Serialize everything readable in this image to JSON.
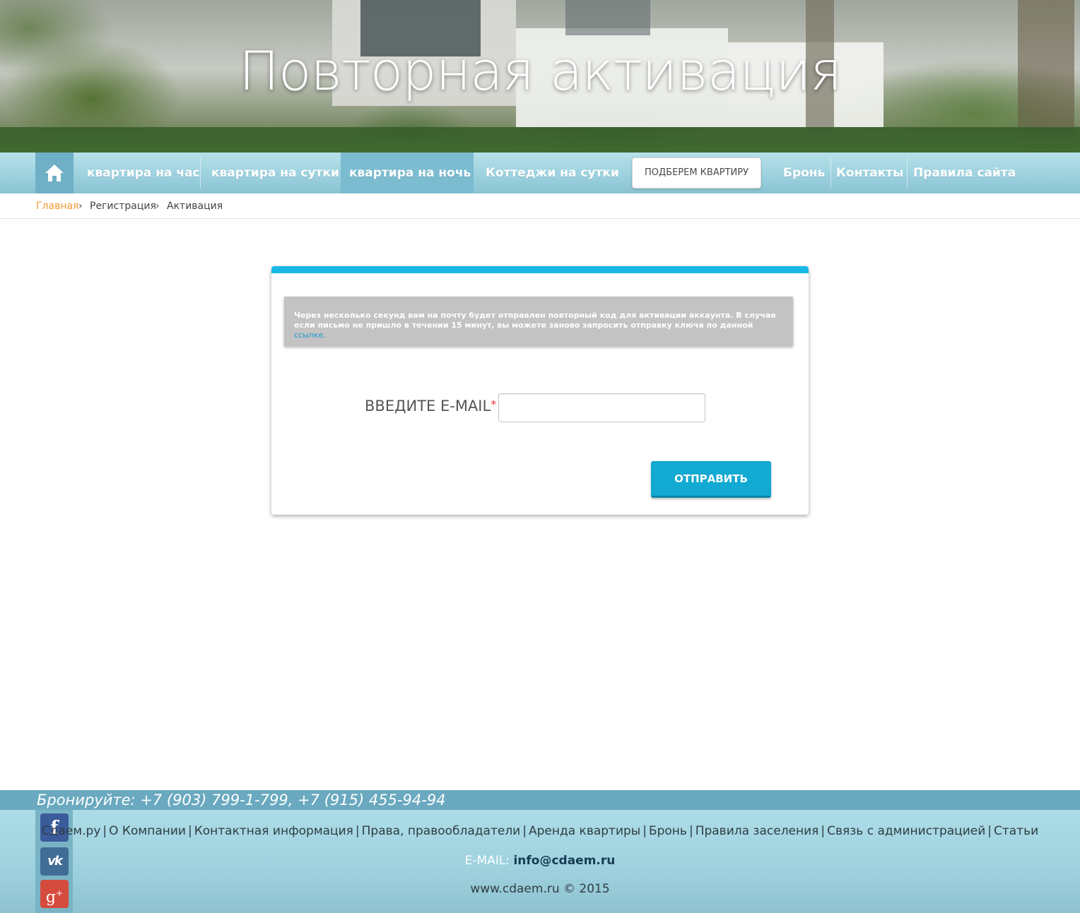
{
  "hero": {
    "title": "Повторная активация"
  },
  "nav": {
    "items": [
      {
        "label": "квартира на час"
      },
      {
        "label": "квартира на сутки"
      },
      {
        "label": "квартира на ночь"
      },
      {
        "label": "Коттеджи на сутки"
      },
      {
        "label": "ПОДБЕРЕМ КВАРТИРУ"
      },
      {
        "label": "Бронь"
      },
      {
        "label": "Контакты"
      },
      {
        "label": "Правила сайта"
      }
    ],
    "active_index": 2
  },
  "breadcrumb": {
    "items": [
      "Главная",
      "Регистрация",
      "Активация"
    ],
    "separator": "›"
  },
  "form": {
    "notice_text": "Через несколько секунд вам на почту будет отправлен повторный код для активации аккаунта. В случае если письмо не пришло в течении 15 минут, вы можете заново запросить отправку ключа по данной",
    "notice_link": "ссылке.",
    "email_label": "ВВЕДИТЕ E-MAIL",
    "required_mark": "*",
    "email_value": "",
    "submit_label": "ОТПРАВИТЬ"
  },
  "footer": {
    "phones": "Бронируйте: +7 (903) 799-1-799, +7 (915) 455-94-94",
    "links": [
      "Сдаем.ру",
      "О Компании",
      "Контактная информация",
      "Права, правообладатели",
      "Аренда квартиры",
      "Бронь",
      "Правила заселения",
      "Связь с администрацией",
      "Статьи"
    ],
    "link_separator": "|",
    "email_label": "E-MAIL:",
    "email_value": "info@cdaem.ru",
    "copyright": "www.cdaem.ru © 2015",
    "social": [
      {
        "icon": "facebook-icon",
        "glyph": "f"
      },
      {
        "icon": "vk-icon",
        "glyph": "vk"
      },
      {
        "icon": "google-plus-icon",
        "glyph": "g"
      }
    ]
  },
  "colors": {
    "accent": "#19b7e6",
    "button": "#12a9d2",
    "breadcrumb_home": "#f29a2e",
    "nav_bg": "#9fd3e0"
  }
}
